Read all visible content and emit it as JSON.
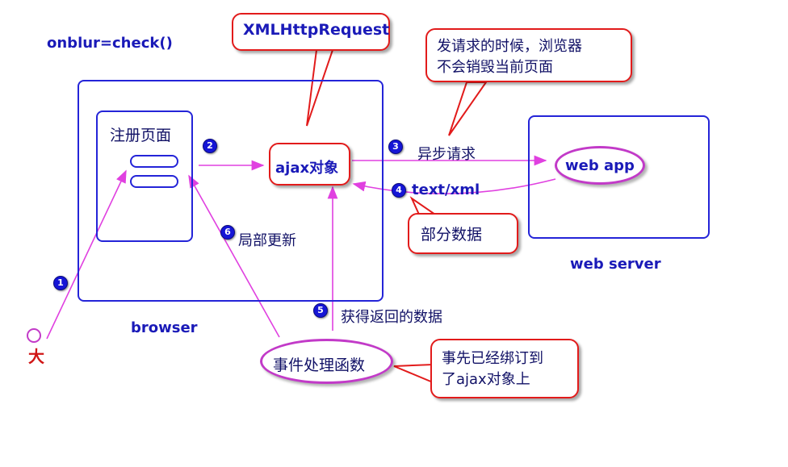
{
  "labels": {
    "event_attr": "onblur=check()",
    "xhr_callout": "XMLHttpRequest",
    "no_destroy_callout_line1": "发请求的时候，浏览器",
    "no_destroy_callout_line2": "不会销毁当前页面",
    "register_page": "注册页面",
    "ajax_object": "ajax对象",
    "async_request": "异步请求",
    "text_xml": "text/xml",
    "partial_data": "部分数据",
    "web_app": "web app",
    "web_server": "web server",
    "browser": "browser",
    "partial_update": "局部更新",
    "get_returned_data": "获得返回的数据",
    "event_handler": "事件处理函数",
    "bound_callout_line1": "事先已经绑订到",
    "bound_callout_line2": "了ajax对象上",
    "user_glyph": "大"
  },
  "steps": {
    "s1": "1",
    "s2": "2",
    "s3": "3",
    "s4": "4",
    "s5": "5",
    "s6": "6"
  },
  "colors": {
    "text_blue": "#1a1ab8",
    "box_blue": "#2424d8",
    "callout_red": "#e21b1b",
    "arrow_magenta": "#e040e0",
    "ellipse_purple": "#c23ac8"
  }
}
